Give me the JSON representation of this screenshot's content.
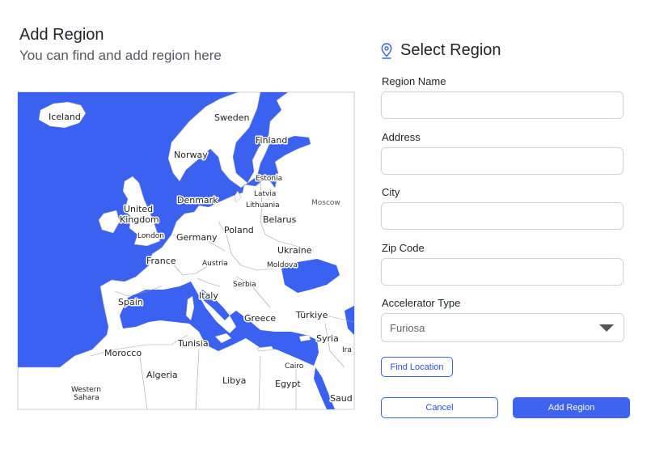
{
  "header": {
    "title": "Add Region",
    "subtitle": "You can find and add region here"
  },
  "map": {
    "water_color": "#3a61f0",
    "land_color": "#ffffff",
    "labels": {
      "iceland": "Iceland",
      "sweden": "Sweden",
      "finland": "Finland",
      "norway": "Norway",
      "estonia": "Estonia",
      "latvia": "Latvia",
      "lithuania": "Lithuania",
      "denmark": "Denmark",
      "moscow": "Moscow",
      "united": "United",
      "kingdom": "Kingdom",
      "belarus": "Belarus",
      "london": "London",
      "poland": "Poland",
      "germany": "Germany",
      "ukraine": "Ukraine",
      "france": "France",
      "austria": "Austria",
      "moldova": "Moldova",
      "serbia": "Serbia",
      "italy": "Italy",
      "spain": "Spain",
      "turkiye": "Türkiye",
      "greece": "Greece",
      "syria": "Syria",
      "tunisia": "Tunisia",
      "iraq": "Ira",
      "morocco": "Morocco",
      "algeria": "Algeria",
      "cairo": "Cairo",
      "libya": "Libya",
      "egypt": "Egypt",
      "western": "Western",
      "sahara": "Sahara",
      "saudi": "Saud"
    }
  },
  "form": {
    "title": "Select Region",
    "region_name_label": "Region Name",
    "region_name_value": "",
    "address_label": "Address",
    "address_value": "",
    "city_label": "City",
    "city_value": "",
    "zip_label": "Zip Code",
    "zip_value": "",
    "accelerator_label": "Accelerator Type",
    "accelerator_value": "Furiosa",
    "find_location_label": "Find Location",
    "cancel_label": "Cancel",
    "add_region_label": "Add Region"
  },
  "colors": {
    "accent": "#3d63f0",
    "text": "#1f2328",
    "border": "#cfd3d8"
  }
}
